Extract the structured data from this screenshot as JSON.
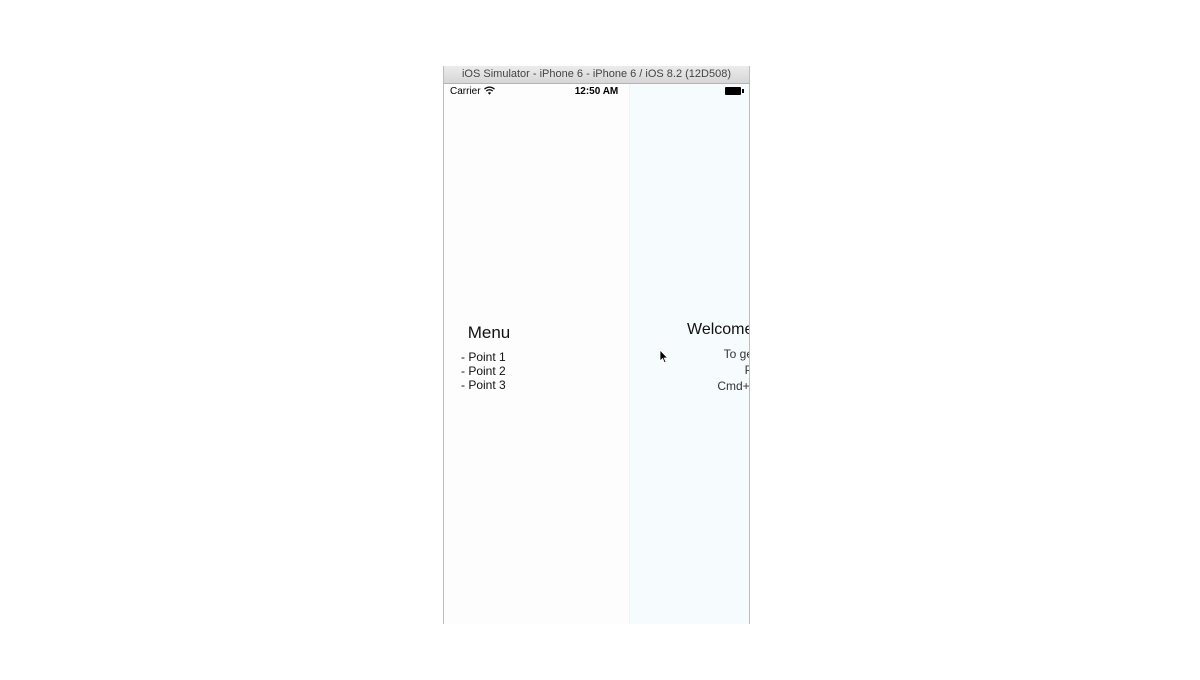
{
  "window": {
    "title": "iOS Simulator - iPhone 6 - iPhone 6 / iOS 8.2 (12D508)"
  },
  "statusbar": {
    "carrier": "Carrier",
    "time": "12:50 AM",
    "icons": [
      "wifi-icon",
      "battery-icon"
    ]
  },
  "menu": {
    "title": "Menu",
    "items": [
      "- Point 1",
      "- Point 2",
      "- Point 3"
    ]
  },
  "main": {
    "title": "Welcome",
    "lines": [
      "To get started",
      "Press",
      "Cmd+Control+Z"
    ]
  },
  "colors": {
    "menu_background": "#fdfdfd",
    "main_background": "#f6fbfd",
    "titlebar": "#dedede"
  }
}
